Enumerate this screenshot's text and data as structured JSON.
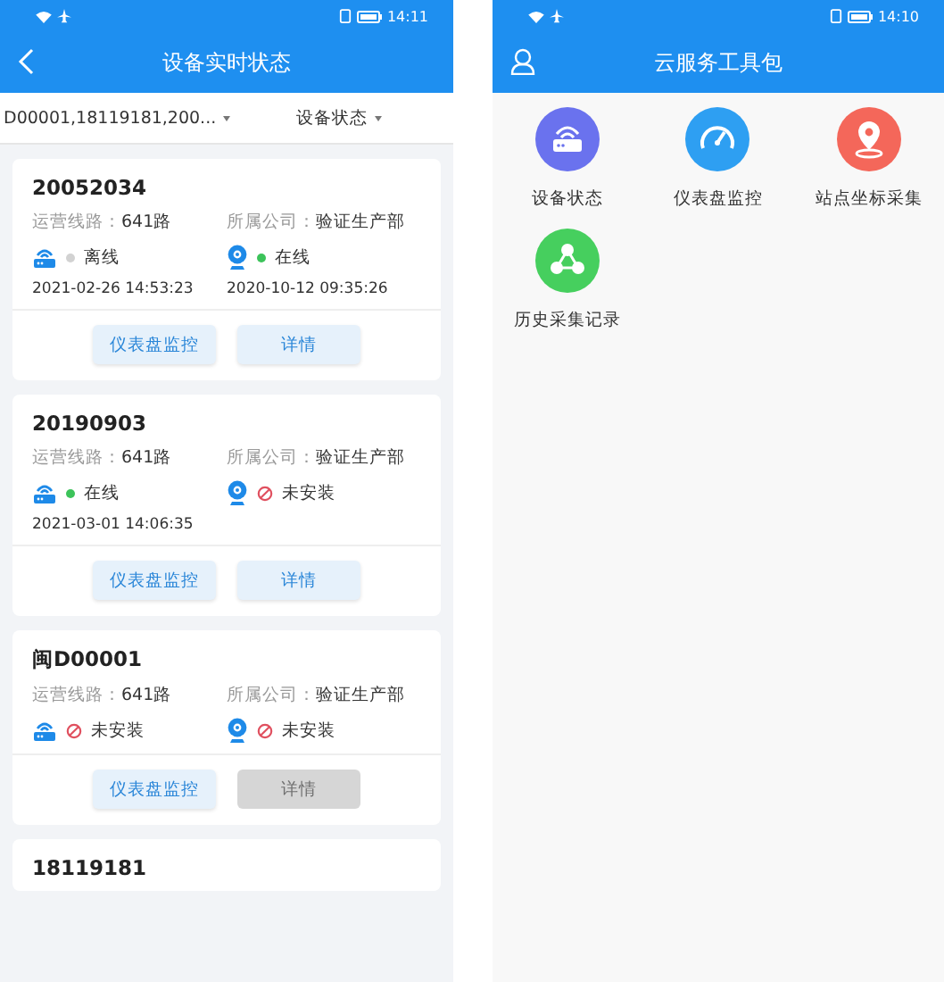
{
  "left_screen": {
    "status_bar": {
      "time": "14:11"
    },
    "header": {
      "title": "设备实时状态"
    },
    "filters": [
      {
        "label": "D00001,18119181,200..."
      },
      {
        "label": "设备状态"
      }
    ],
    "devices": [
      {
        "id": "20052034",
        "line_label": "运营线路：",
        "line": "641路",
        "company_label": "所属公司：",
        "company": "验证生产部",
        "gateway": {
          "kind": "offline",
          "label": "离线",
          "time": "2021-02-26 14:53:23"
        },
        "camera": {
          "kind": "online",
          "label": "在线",
          "time": "2020-10-12 09:35:26"
        },
        "buttons": [
          {
            "label": "仪表盘监控",
            "disabled": false
          },
          {
            "label": "详情",
            "disabled": false
          }
        ]
      },
      {
        "id": "20190903",
        "line_label": "运营线路：",
        "line": "641路",
        "company_label": "所属公司：",
        "company": "验证生产部",
        "gateway": {
          "kind": "online",
          "label": "在线",
          "time": "2021-03-01 14:06:35"
        },
        "camera": {
          "kind": "not_installed",
          "label": "未安装"
        },
        "buttons": [
          {
            "label": "仪表盘监控",
            "disabled": false
          },
          {
            "label": "详情",
            "disabled": false
          }
        ]
      },
      {
        "id": "闽D00001",
        "line_label": "运营线路：",
        "line": "641路",
        "company_label": "所属公司：",
        "company": "验证生产部",
        "gateway": {
          "kind": "not_installed",
          "label": "未安装"
        },
        "camera": {
          "kind": "not_installed",
          "label": "未安装"
        },
        "buttons": [
          {
            "label": "仪表盘监控",
            "disabled": false
          },
          {
            "label": "详情",
            "disabled": true
          }
        ]
      },
      {
        "id": "18119181"
      }
    ]
  },
  "right_screen": {
    "status_bar": {
      "time": "14:10"
    },
    "header": {
      "title": "云服务工具包"
    },
    "tools": [
      {
        "label": "设备状态",
        "kind": "router",
        "color": "#6a72ee"
      },
      {
        "label": "仪表盘监控",
        "kind": "gauge",
        "color": "#2e9ff2"
      },
      {
        "label": "站点坐标采集",
        "kind": "pin",
        "color": "#f4675a"
      },
      {
        "label": "历史采集记录",
        "kind": "nodes",
        "color": "#46cf5e"
      }
    ]
  }
}
